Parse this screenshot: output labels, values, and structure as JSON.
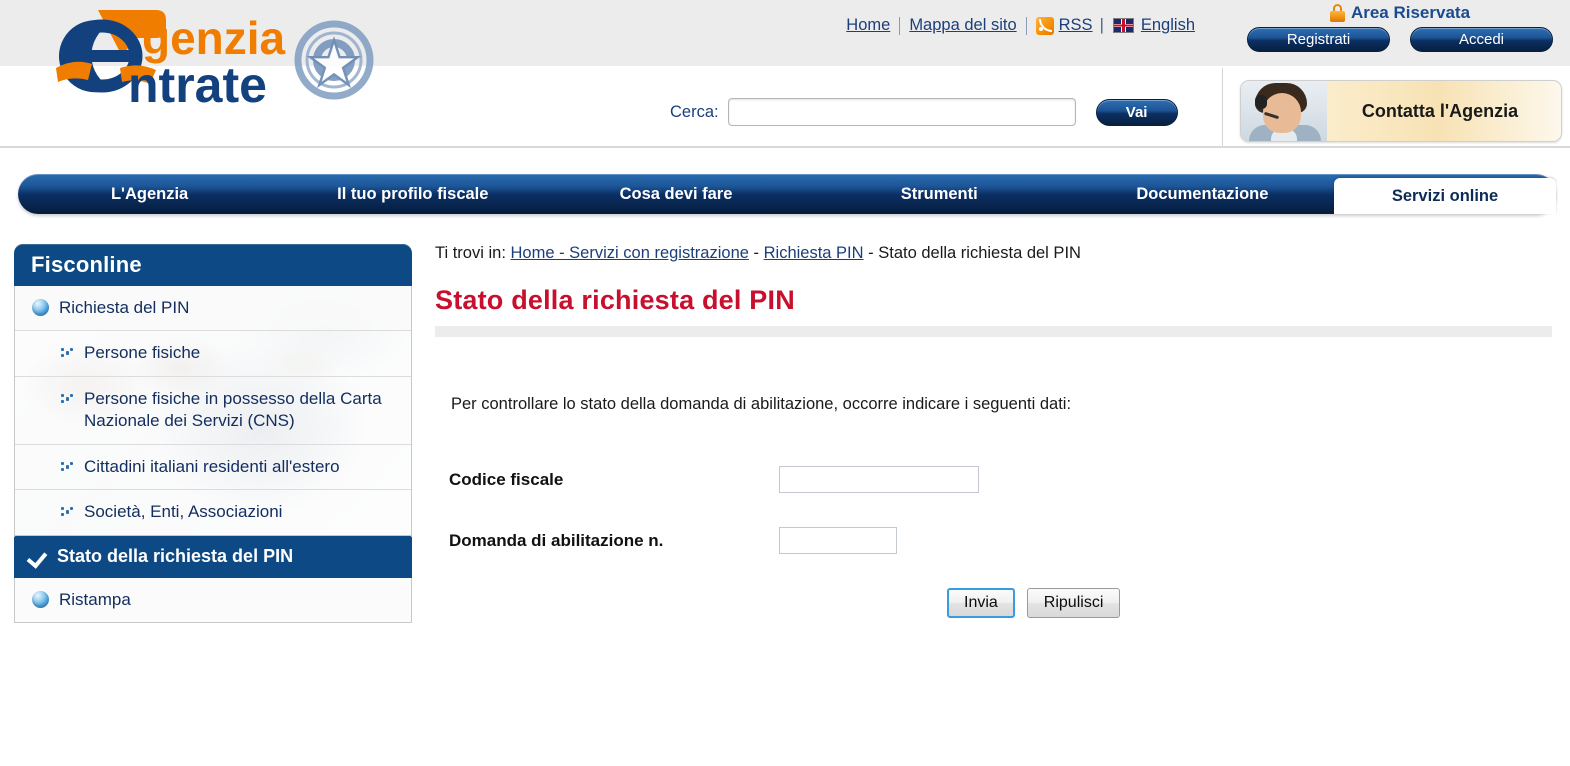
{
  "header": {
    "logo_text_top": "genzia",
    "logo_text_bottom": "ntrate",
    "logo_alt": "Agenzia delle Entrate",
    "emblem_alt": "Emblema della Repubblica Italiana",
    "top_links": [
      {
        "label": "Home",
        "icon": null
      },
      {
        "label": "Mappa del sito",
        "icon": null
      },
      {
        "label": "RSS",
        "icon": "rss-icon"
      },
      {
        "label": "English",
        "icon": "uk-flag-icon"
      }
    ],
    "separator": "|",
    "area_riservata": {
      "title": "Area Riservata",
      "icon": "lock-icon",
      "register_label": "Registrati",
      "login_label": "Accedi"
    },
    "search": {
      "label": "Cerca:",
      "value": "",
      "placeholder": "",
      "button_label": "Vai"
    },
    "contact": {
      "label": "Contatta l'Agenzia",
      "image_alt": "Operatore call center con cuffia"
    }
  },
  "mainnav": {
    "items": [
      {
        "label": "L'Agenzia",
        "active": false
      },
      {
        "label": "Il tuo profilo fiscale",
        "active": false
      },
      {
        "label": "Cosa devi fare",
        "active": false
      },
      {
        "label": "Strumenti",
        "active": false
      },
      {
        "label": "Documentazione",
        "active": false
      },
      {
        "label": "Servizi online",
        "active": true
      }
    ]
  },
  "breadcrumb": {
    "prefix": "Ti trovi in:",
    "link1": "Home - Servizi con registrazione",
    "sep1": "-",
    "link2": "Richiesta PIN",
    "sep2": "-",
    "current": "Stato della richiesta del PIN"
  },
  "sidebar": {
    "header": "Fisconline",
    "items": [
      {
        "label": "Richiesta del PIN",
        "icon": "sphere-icon",
        "level": 1
      },
      {
        "label": "Persone fisiche",
        "icon": "dots-icon",
        "level": 2
      },
      {
        "label": "Persone fisiche in possesso della Carta Nazionale dei Servizi (CNS)",
        "icon": "dots-icon",
        "level": 2
      },
      {
        "label": "Cittadini italiani residenti all'estero",
        "icon": "dots-icon",
        "level": 2
      },
      {
        "label": "Società, Enti, Associazioni",
        "icon": "dots-icon",
        "level": 2
      }
    ],
    "active_section": {
      "label": "Stato della richiesta del PIN",
      "icon": "check-icon"
    },
    "after_items": [
      {
        "label": "Ristampa",
        "icon": "sphere-icon",
        "level": 1
      }
    ]
  },
  "main": {
    "title": "Stato della richiesta del PIN",
    "intro": "Per controllare lo stato della domanda di abilitazione, occorre indicare i seguenti dati:",
    "form": {
      "fields": [
        {
          "label": "Codice fiscale",
          "value": "",
          "placeholder": "",
          "name": "codice-fiscale"
        },
        {
          "label": "Domanda di abilitazione n.",
          "value": "",
          "placeholder": "",
          "name": "domanda-abilitazione"
        }
      ],
      "submit_label": "Invia",
      "reset_label": "Ripulisci"
    }
  },
  "colors": {
    "brand_blue": "#0d4a85",
    "brand_orange": "#f07d00",
    "title_red": "#c8102e",
    "nav_dark": "#061d3c",
    "link_blue": "#1b3f7a"
  }
}
